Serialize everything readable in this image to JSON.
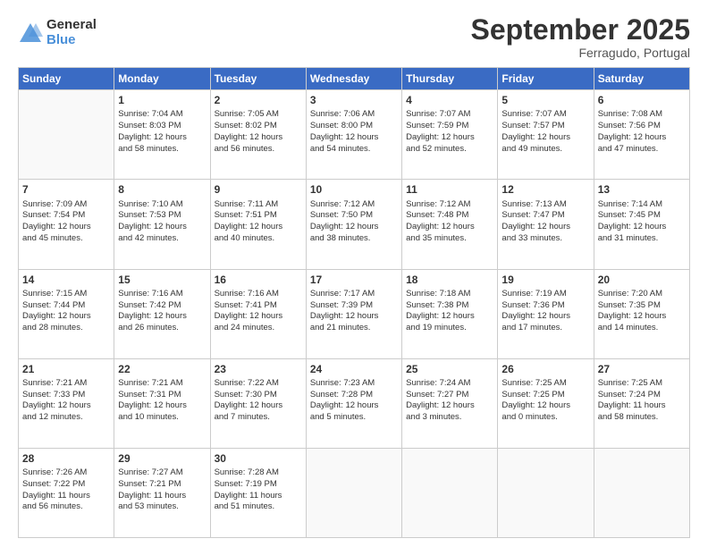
{
  "logo": {
    "general": "General",
    "blue": "Blue"
  },
  "header": {
    "month": "September 2025",
    "location": "Ferragudo, Portugal"
  },
  "days_header": [
    "Sunday",
    "Monday",
    "Tuesday",
    "Wednesday",
    "Thursday",
    "Friday",
    "Saturday"
  ],
  "weeks": [
    [
      {
        "num": "",
        "lines": []
      },
      {
        "num": "1",
        "lines": [
          "Sunrise: 7:04 AM",
          "Sunset: 8:03 PM",
          "Daylight: 12 hours",
          "and 58 minutes."
        ]
      },
      {
        "num": "2",
        "lines": [
          "Sunrise: 7:05 AM",
          "Sunset: 8:02 PM",
          "Daylight: 12 hours",
          "and 56 minutes."
        ]
      },
      {
        "num": "3",
        "lines": [
          "Sunrise: 7:06 AM",
          "Sunset: 8:00 PM",
          "Daylight: 12 hours",
          "and 54 minutes."
        ]
      },
      {
        "num": "4",
        "lines": [
          "Sunrise: 7:07 AM",
          "Sunset: 7:59 PM",
          "Daylight: 12 hours",
          "and 52 minutes."
        ]
      },
      {
        "num": "5",
        "lines": [
          "Sunrise: 7:07 AM",
          "Sunset: 7:57 PM",
          "Daylight: 12 hours",
          "and 49 minutes."
        ]
      },
      {
        "num": "6",
        "lines": [
          "Sunrise: 7:08 AM",
          "Sunset: 7:56 PM",
          "Daylight: 12 hours",
          "and 47 minutes."
        ]
      }
    ],
    [
      {
        "num": "7",
        "lines": [
          "Sunrise: 7:09 AM",
          "Sunset: 7:54 PM",
          "Daylight: 12 hours",
          "and 45 minutes."
        ]
      },
      {
        "num": "8",
        "lines": [
          "Sunrise: 7:10 AM",
          "Sunset: 7:53 PM",
          "Daylight: 12 hours",
          "and 42 minutes."
        ]
      },
      {
        "num": "9",
        "lines": [
          "Sunrise: 7:11 AM",
          "Sunset: 7:51 PM",
          "Daylight: 12 hours",
          "and 40 minutes."
        ]
      },
      {
        "num": "10",
        "lines": [
          "Sunrise: 7:12 AM",
          "Sunset: 7:50 PM",
          "Daylight: 12 hours",
          "and 38 minutes."
        ]
      },
      {
        "num": "11",
        "lines": [
          "Sunrise: 7:12 AM",
          "Sunset: 7:48 PM",
          "Daylight: 12 hours",
          "and 35 minutes."
        ]
      },
      {
        "num": "12",
        "lines": [
          "Sunrise: 7:13 AM",
          "Sunset: 7:47 PM",
          "Daylight: 12 hours",
          "and 33 minutes."
        ]
      },
      {
        "num": "13",
        "lines": [
          "Sunrise: 7:14 AM",
          "Sunset: 7:45 PM",
          "Daylight: 12 hours",
          "and 31 minutes."
        ]
      }
    ],
    [
      {
        "num": "14",
        "lines": [
          "Sunrise: 7:15 AM",
          "Sunset: 7:44 PM",
          "Daylight: 12 hours",
          "and 28 minutes."
        ]
      },
      {
        "num": "15",
        "lines": [
          "Sunrise: 7:16 AM",
          "Sunset: 7:42 PM",
          "Daylight: 12 hours",
          "and 26 minutes."
        ]
      },
      {
        "num": "16",
        "lines": [
          "Sunrise: 7:16 AM",
          "Sunset: 7:41 PM",
          "Daylight: 12 hours",
          "and 24 minutes."
        ]
      },
      {
        "num": "17",
        "lines": [
          "Sunrise: 7:17 AM",
          "Sunset: 7:39 PM",
          "Daylight: 12 hours",
          "and 21 minutes."
        ]
      },
      {
        "num": "18",
        "lines": [
          "Sunrise: 7:18 AM",
          "Sunset: 7:38 PM",
          "Daylight: 12 hours",
          "and 19 minutes."
        ]
      },
      {
        "num": "19",
        "lines": [
          "Sunrise: 7:19 AM",
          "Sunset: 7:36 PM",
          "Daylight: 12 hours",
          "and 17 minutes."
        ]
      },
      {
        "num": "20",
        "lines": [
          "Sunrise: 7:20 AM",
          "Sunset: 7:35 PM",
          "Daylight: 12 hours",
          "and 14 minutes."
        ]
      }
    ],
    [
      {
        "num": "21",
        "lines": [
          "Sunrise: 7:21 AM",
          "Sunset: 7:33 PM",
          "Daylight: 12 hours",
          "and 12 minutes."
        ]
      },
      {
        "num": "22",
        "lines": [
          "Sunrise: 7:21 AM",
          "Sunset: 7:31 PM",
          "Daylight: 12 hours",
          "and 10 minutes."
        ]
      },
      {
        "num": "23",
        "lines": [
          "Sunrise: 7:22 AM",
          "Sunset: 7:30 PM",
          "Daylight: 12 hours",
          "and 7 minutes."
        ]
      },
      {
        "num": "24",
        "lines": [
          "Sunrise: 7:23 AM",
          "Sunset: 7:28 PM",
          "Daylight: 12 hours",
          "and 5 minutes."
        ]
      },
      {
        "num": "25",
        "lines": [
          "Sunrise: 7:24 AM",
          "Sunset: 7:27 PM",
          "Daylight: 12 hours",
          "and 3 minutes."
        ]
      },
      {
        "num": "26",
        "lines": [
          "Sunrise: 7:25 AM",
          "Sunset: 7:25 PM",
          "Daylight: 12 hours",
          "and 0 minutes."
        ]
      },
      {
        "num": "27",
        "lines": [
          "Sunrise: 7:25 AM",
          "Sunset: 7:24 PM",
          "Daylight: 11 hours",
          "and 58 minutes."
        ]
      }
    ],
    [
      {
        "num": "28",
        "lines": [
          "Sunrise: 7:26 AM",
          "Sunset: 7:22 PM",
          "Daylight: 11 hours",
          "and 56 minutes."
        ]
      },
      {
        "num": "29",
        "lines": [
          "Sunrise: 7:27 AM",
          "Sunset: 7:21 PM",
          "Daylight: 11 hours",
          "and 53 minutes."
        ]
      },
      {
        "num": "30",
        "lines": [
          "Sunrise: 7:28 AM",
          "Sunset: 7:19 PM",
          "Daylight: 11 hours",
          "and 51 minutes."
        ]
      },
      {
        "num": "",
        "lines": []
      },
      {
        "num": "",
        "lines": []
      },
      {
        "num": "",
        "lines": []
      },
      {
        "num": "",
        "lines": []
      }
    ]
  ]
}
